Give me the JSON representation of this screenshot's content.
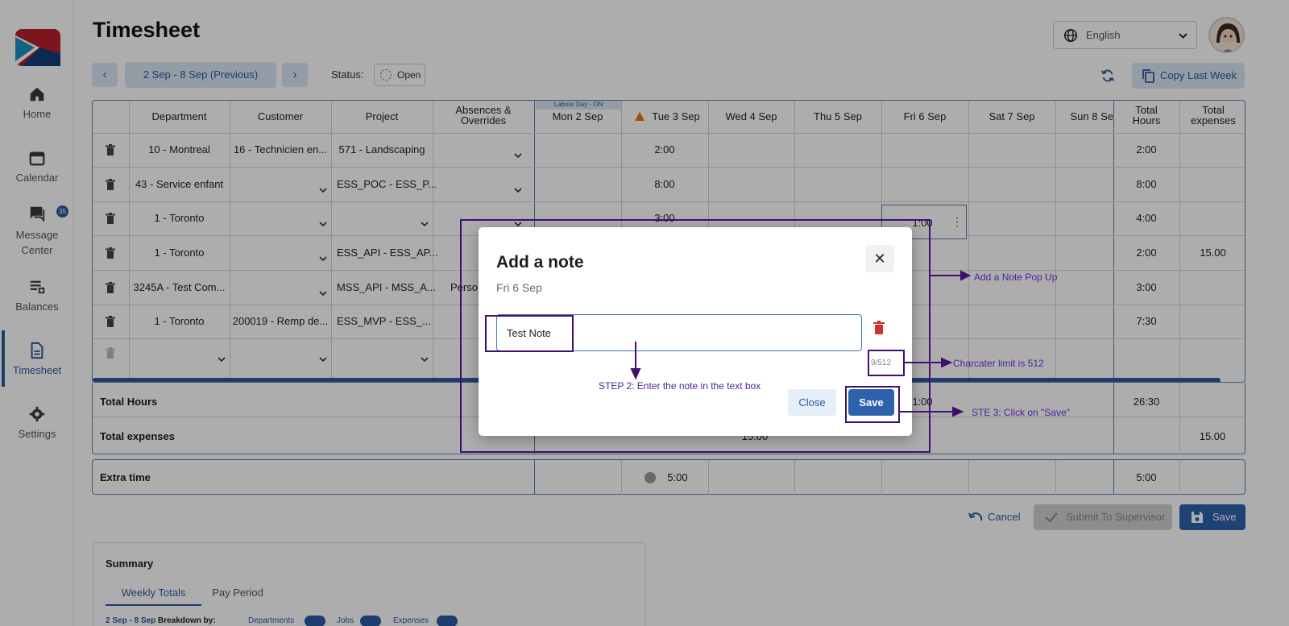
{
  "sidebar": {
    "items": [
      {
        "label": "Home",
        "icon": "home-icon"
      },
      {
        "label": "Calendar",
        "icon": "calendar-icon"
      },
      {
        "label": "Message Center",
        "icon": "chat-icon",
        "badge": "35"
      },
      {
        "label": "Balances",
        "icon": "balances-icon"
      },
      {
        "label": "Timesheet",
        "icon": "document-icon",
        "active": true
      },
      {
        "label": "Settings",
        "icon": "gear-icon"
      }
    ]
  },
  "header": {
    "title": "Timesheet",
    "period": "2 Sep - 8 Sep (Previous)",
    "status_label": "Status:",
    "status_value": "Open",
    "language": "English",
    "copy_last_week": "Copy Last Week"
  },
  "table": {
    "columns": [
      "Department",
      "Customer",
      "Project",
      "Absences & Overrides",
      "Mon 2 Sep",
      "Tue 3 Sep",
      "Wed 4 Sep",
      "Thu 5 Sep",
      "Fri 6 Sep",
      "Sat 7 Sep",
      "Sun 8 Se",
      "Total Hours",
      "Total expenses"
    ],
    "holiday_note": "Labour Day - ON",
    "rows": [
      {
        "department": "10 - Montreal",
        "customer": "16 - Technicien en...",
        "project": "571 - Landscaping",
        "absence": "",
        "tue": "2:00",
        "fri": "",
        "total": "2:00",
        "expenses": ""
      },
      {
        "department": "43 - Service enfant",
        "customer": "",
        "project": "ESS_POC - ESS_P...",
        "absence": "",
        "tue": "8:00",
        "fri": "",
        "total": "8:00",
        "expenses": ""
      },
      {
        "department": "1 - Toronto",
        "customer": "",
        "project": "",
        "absence": "",
        "tue": "3:00",
        "fri": "1:00",
        "total": "4:00",
        "expenses": ""
      },
      {
        "department": "1 - Toronto",
        "customer": "",
        "project": "ESS_API - ESS_AP...",
        "absence": "",
        "tue": "",
        "fri": "",
        "total": "2:00",
        "expenses": "15.00"
      },
      {
        "department": "3245A - Test Com...",
        "customer": "",
        "project": "MSS_API - MSS_A...",
        "absence": "Perso",
        "tue": "",
        "fri": "",
        "total": "3:00",
        "expenses": ""
      },
      {
        "department": "1 - Toronto",
        "customer": "200019 - Remp de...",
        "project": "ESS_MVP - ESS_...",
        "absence": "",
        "tue": "",
        "fri": "",
        "total": "7:30",
        "expenses": ""
      }
    ],
    "total_hours_label": "Total Hours",
    "total_hours_fri": "1:00",
    "total_hours_sum": "26:30",
    "total_expenses_label": "Total expenses",
    "total_expenses_wed": "15.00",
    "total_expenses_sum": "15.00",
    "extra_time_label": "Extra time",
    "extra_time_tue": "5:00",
    "extra_time_total": "5:00"
  },
  "actions": {
    "cancel": "Cancel",
    "submit": "Submit To Supervisor",
    "save": "Save"
  },
  "summary": {
    "title": "Summary",
    "tabs": [
      "Weekly Totals",
      "Pay Period"
    ],
    "range": "2 Sep - 8 Sep",
    "breakdown_label": "Breakdown by:",
    "toggles": [
      "Departments",
      "Jobs",
      "Expenses"
    ]
  },
  "modal": {
    "title": "Add a note",
    "subtitle": "Fri 6 Sep",
    "note_value": "Test Note",
    "char_count": "9/512",
    "close_label": "Close",
    "save_label": "Save"
  },
  "annotations": {
    "popup": "Add a Note Pop Up",
    "limit": "Charcater limit is 512",
    "step2": "STEP 2: Enter the note in the text box",
    "step3": "STE 3: Click on \"Save\""
  },
  "colors": {
    "accent": "#2c5aa0",
    "annotation": "#4b1fa0",
    "delete": "#d32f2f"
  }
}
